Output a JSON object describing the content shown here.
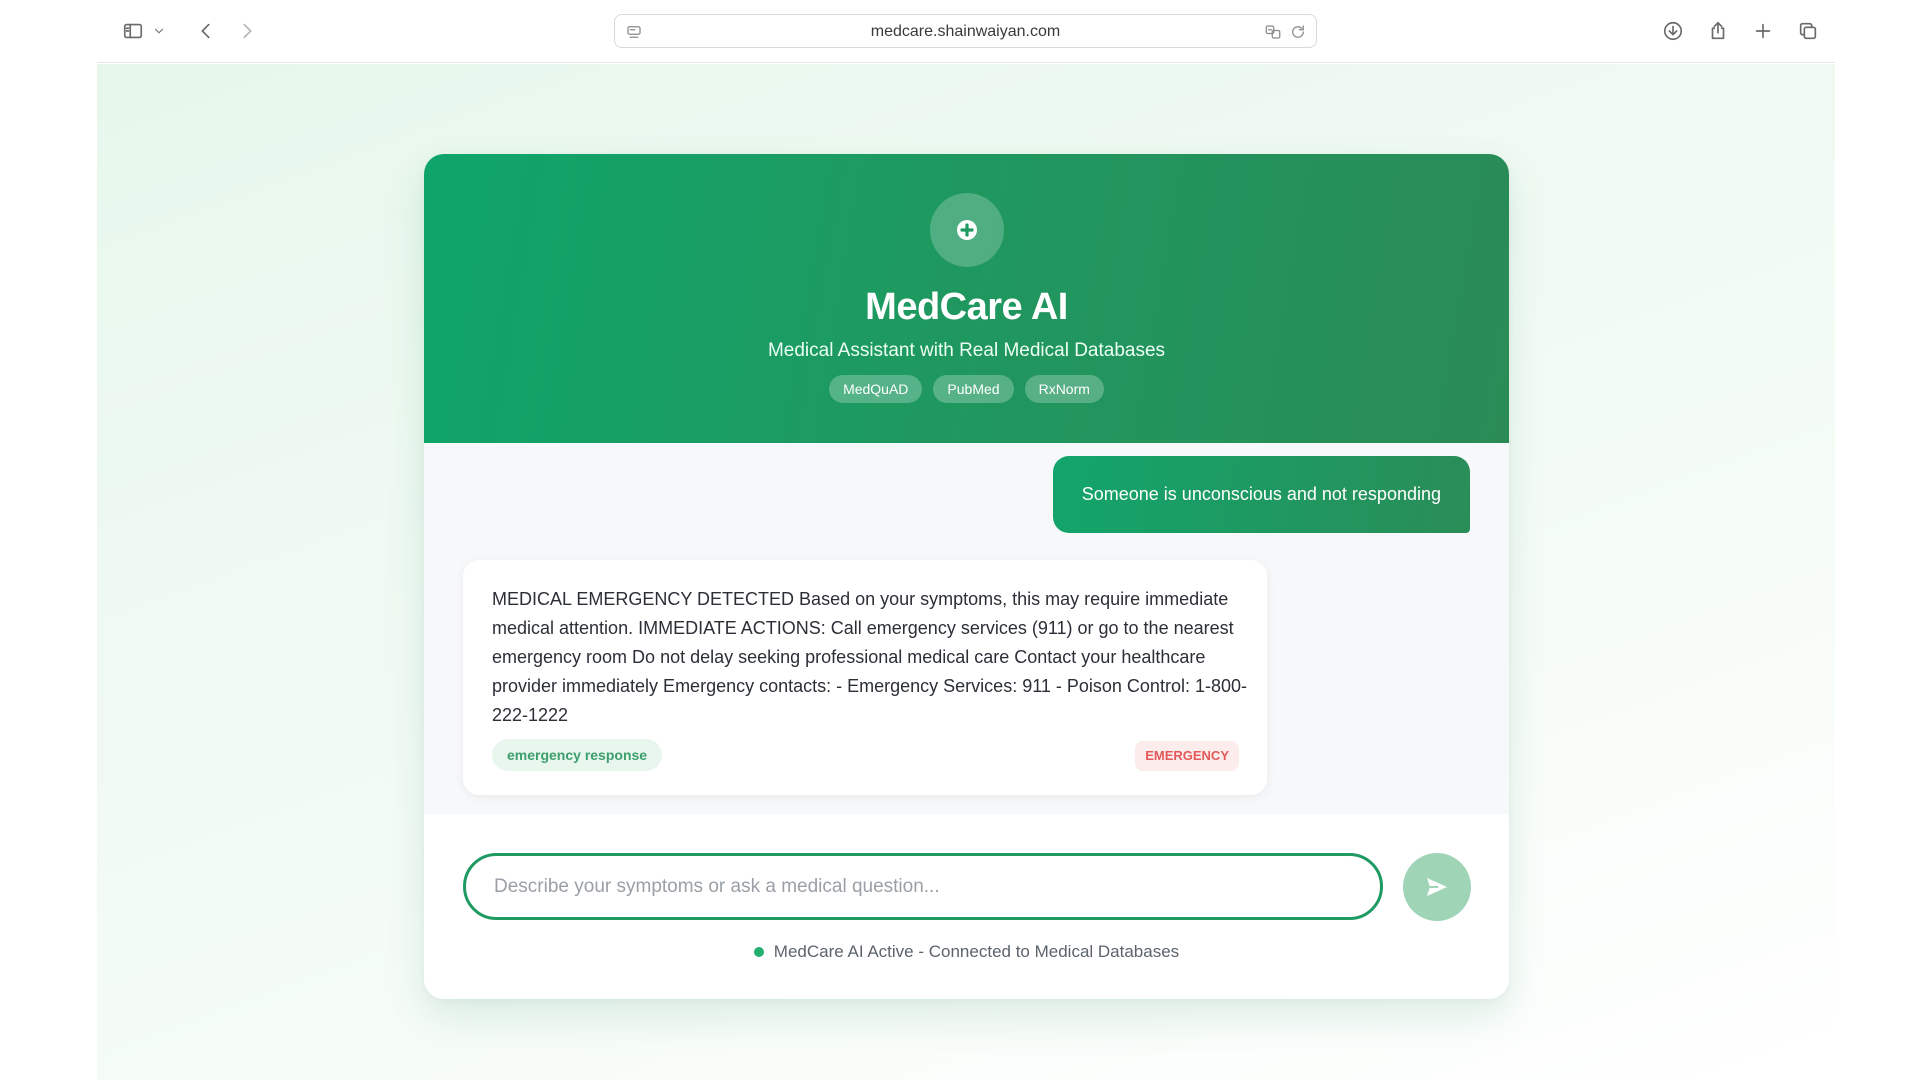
{
  "browser": {
    "url": "medcare.shainwaiyan.com"
  },
  "header": {
    "title": "MedCare AI",
    "subtitle": "Medical Assistant with Real Medical Databases",
    "sources": [
      "MedQuAD",
      "PubMed",
      "RxNorm"
    ]
  },
  "chat": {
    "user_message": "Someone is unconscious and not responding",
    "bot_message": {
      "text": "MEDICAL EMERGENCY DETECTED Based on your symptoms, this may require immediate medical attention. IMMEDIATE ACTIONS: Call emergency services (911) or go to the nearest emergency room Do not delay seeking professional medical care Contact your healthcare provider immediately Emergency contacts: - Emergency Services: 911 - Poison Control: 1-800-222-1222",
      "type_tag": "emergency response",
      "badge": "EMERGENCY"
    }
  },
  "input": {
    "placeholder": "Describe your symptoms or ask a medical question...",
    "value": ""
  },
  "status": {
    "text": "MedCare AI Active - Connected to Medical Databases"
  },
  "colors": {
    "brand_green": "#1e9a62",
    "emergency_red": "#e35a5a"
  }
}
